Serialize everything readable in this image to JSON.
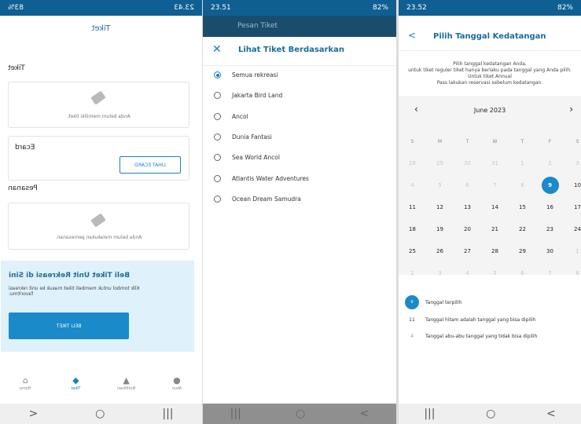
{
  "panel1": {
    "status_time": "23.43",
    "status_battery": "83%",
    "title": "Tiket",
    "section_tiket": "Tiket",
    "tiket_empty": "Anda belum memiliki tiket.",
    "section_ecard": "Ecard",
    "lihat_ecard": "LIHAT ECARD",
    "section_pesanan": "Pesanan",
    "pesanan_empty": "Anda belum melakukan pemesanan.",
    "promo_title": "Beli Tiket Unit Rekreasi di Sini",
    "promo_text": "Klik tombol untuk membeli tiket masuk ke unit rekreasi favoritmu:",
    "beli_tiket": "BELI TIKET",
    "tabs": [
      "Akun",
      "Notifikasi",
      "Tiket",
      "Home"
    ]
  },
  "panel2": {
    "status_time": "23.51",
    "status_battery": "82%",
    "behind_title": "Pesan Tiket",
    "sheet_title": "Lihat Tiket Berdasarkan",
    "options": [
      "Semua rekreasi",
      "Jakarta Bird Land",
      "Ancol",
      "Dunia Fantasi",
      "Sea World Ancol",
      "Atlantis Water Adventures",
      "Ocean Dream Samudra"
    ],
    "selected_index": 0
  },
  "panel3": {
    "status_time": "23.52",
    "status_battery": "82%",
    "title": "Pilih Tanggal Kedatangan",
    "notice_1": "Pilih tanggal kedatangan Anda,",
    "notice_2": "untuk tiket reguler tiket hanya berlaku pada tanggal yang Anda pilih.",
    "notice_3": "Untuk tiket Annual",
    "notice_4": "Pass lakukan reservasi sebelum kedatangan.",
    "month": "June 2023",
    "weekdays": [
      "S",
      "M",
      "T",
      "W",
      "T",
      "F",
      "S"
    ],
    "days": [
      [
        "28",
        "29",
        "30",
        "31",
        "1",
        "2",
        "3"
      ],
      [
        "4",
        "5",
        "6",
        "7",
        "8",
        "9",
        "10"
      ],
      [
        "11",
        "12",
        "13",
        "14",
        "15",
        "16",
        "17"
      ],
      [
        "18",
        "19",
        "20",
        "21",
        "22",
        "23",
        "24"
      ],
      [
        "25",
        "26",
        "27",
        "28",
        "29",
        "30",
        "1"
      ],
      [
        "2",
        "3",
        "4",
        "5",
        "6",
        "7",
        "8"
      ]
    ],
    "dim_flags": [
      [
        1,
        1,
        1,
        1,
        1,
        1,
        1
      ],
      [
        1,
        1,
        1,
        1,
        1,
        0,
        0
      ],
      [
        0,
        0,
        0,
        0,
        0,
        0,
        0
      ],
      [
        0,
        0,
        0,
        0,
        0,
        0,
        0
      ],
      [
        0,
        0,
        0,
        0,
        0,
        0,
        1
      ],
      [
        1,
        1,
        1,
        1,
        1,
        1,
        1
      ]
    ],
    "selected_day": "9",
    "legend_selected_num": "9",
    "legend_selected": "Tanggal terpilih",
    "legend_black_num": "11",
    "legend_black": "Tanggal hitam adalah tanggal yang bisa dipilih",
    "legend_gray_num": "4",
    "legend_gray": "Tanggal abu-abu tanggal yang tidak bisa dipilih"
  },
  "colors": {
    "primary": "#1a8ac9",
    "statusbar": "#0f5f92"
  }
}
